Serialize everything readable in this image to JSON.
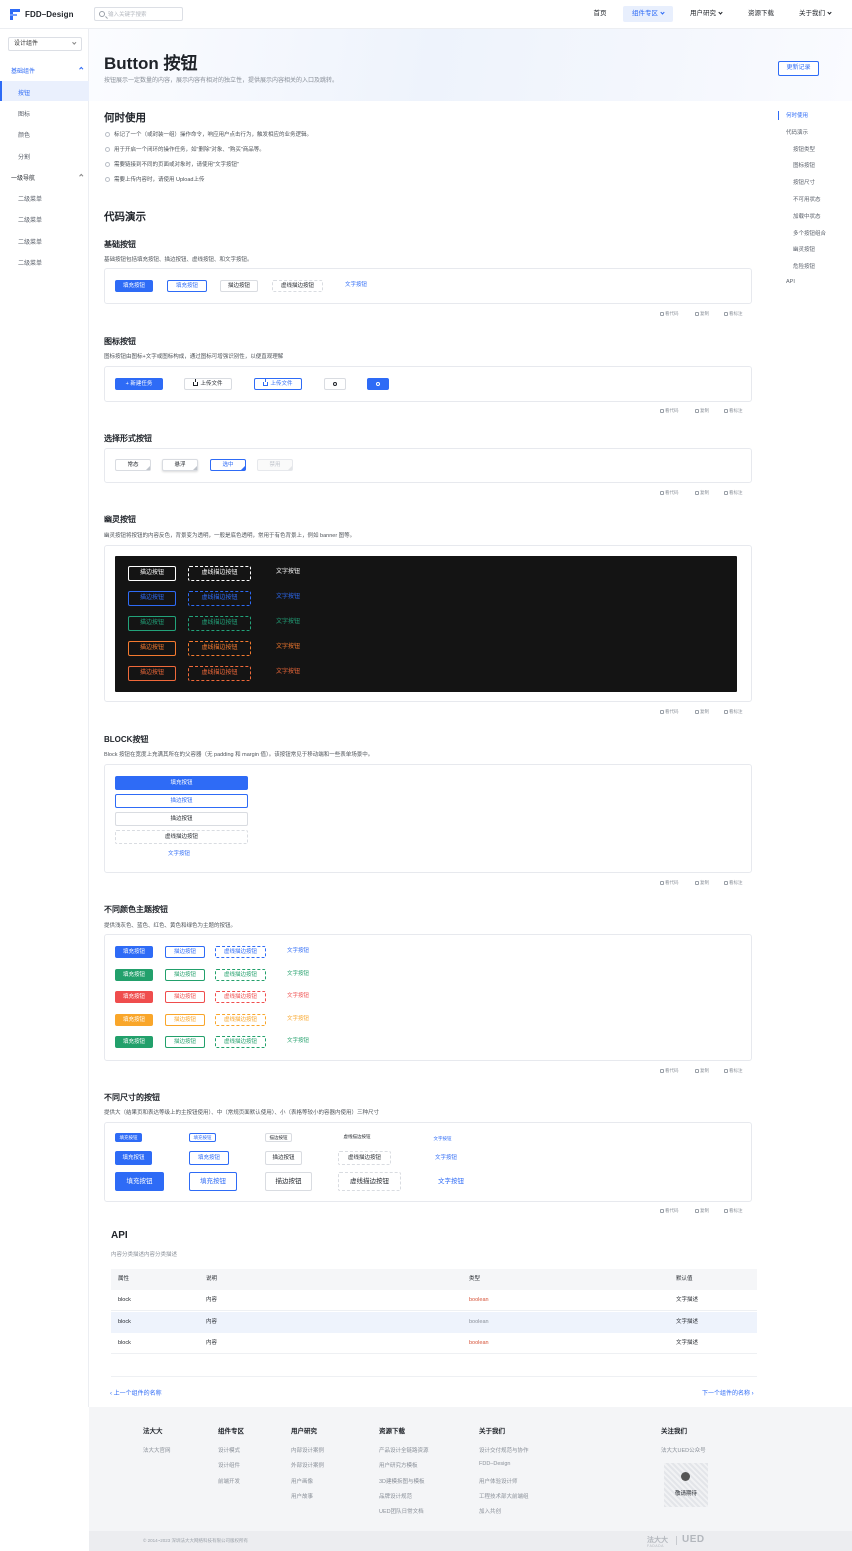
{
  "header": {
    "brand": "FDD–Design",
    "search_placeholder": "输入关键字搜索",
    "nav": [
      "首页",
      "组件专区",
      "用户研究",
      "资源下载",
      "关于我们"
    ]
  },
  "sidebar": {
    "select_value": "设计组件",
    "groups": [
      {
        "label": "基础组件",
        "items": [
          "按钮",
          "图标",
          "颜色",
          "分割"
        ]
      },
      {
        "label": "一级导航",
        "items": [
          "二级菜单",
          "二级菜单",
          "二级菜单",
          "二级菜单"
        ]
      }
    ]
  },
  "page": {
    "title": "Button 按钮",
    "subtitle": "按钮展示一定数量的内容，展示内容有相对的独立性，提供展示内容相关的入口及跳转。",
    "changelog_label": "更新记录"
  },
  "when_to_use": {
    "title": "何时使用",
    "bullets": [
      "标记了一个（或封装一组）操作命令，响应用户点击行为，触发相应的业务逻辑。",
      "用于开启一个闭环的操作任务，如\"删除\"对象、\"购买\"商品等。",
      "需要链接到不同的页面或对象时，请使用\"文字按钮\"",
      "需要上传内容时，请使用 Upload上传"
    ]
  },
  "code_demo_title": "代码演示",
  "tools": [
    "看代码",
    "复制",
    "看标注"
  ],
  "sections": {
    "basic": {
      "title": "基础按钮",
      "desc": "基础按钮包括填充按钮、描边按钮、虚线按钮、和文字按钮。",
      "buttons": [
        "填充按钮",
        "填充按钮",
        "描边按钮",
        "虚线描边按钮",
        "文字按钮"
      ]
    },
    "icon": {
      "title": "图标按钮",
      "desc": "图标按钮由图标+文字或图标构成，通过图标可增强识别性，以便直观理解",
      "buttons": [
        "新建任务",
        "上传文件",
        "上传文件"
      ]
    },
    "choice": {
      "title": "选择形式按钮",
      "buttons": [
        "常态",
        "悬浮",
        "选中",
        "禁用"
      ]
    },
    "ghost": {
      "title": "幽灵按钮",
      "desc": "幽灵按钮将按钮的内容反色，背景变为透明，一般是底色透明，常用于有色背景上，例如 banner 图等。",
      "labels": [
        "描边按钮",
        "虚线描边按钮",
        "文字按钮"
      ],
      "colors": [
        "#ffffff",
        "#2e6bf6",
        "#22a37a",
        "#f57a2f",
        "#f0693a"
      ]
    },
    "block": {
      "title": "BLOCK按钮",
      "desc": "Block 按钮在宽度上充满其所在的父容器（无 padding 和 margin 值）。该按钮常见于移动端和一些表单场景中。",
      "buttons": [
        "填充按钮",
        "描边按钮",
        "描边按钮",
        "虚线描边按钮",
        "文字按钮"
      ]
    },
    "theme": {
      "title": "不同颜色主题按钮",
      "desc": "提供浅灰色、蓝色、红色、黄色和绿色为主题的按钮。",
      "labels": [
        "填充按钮",
        "描边按钮",
        "虚线描边按钮",
        "文字按钮"
      ],
      "colors": [
        "#2e6bf6",
        "#22a06b",
        "#ef4d4d",
        "#f9a62a",
        "#22a06b"
      ]
    },
    "size": {
      "title": "不同尺寸的按钮",
      "desc": "提供大（结果页和表达等级上的主按钮使用）、中（常规页面默认使用）、小（表格等较小的容器内使用）三种尺寸",
      "labels": [
        "填充按钮",
        "填充按钮",
        "描边按钮",
        "虚线描边按钮",
        "文字按钮"
      ]
    }
  },
  "api": {
    "title": "API",
    "subtitle": "内容分类描述内容分类描述",
    "columns": [
      "属性",
      "说明",
      "类型",
      "默认值"
    ],
    "rows": [
      [
        "block",
        "内容",
        "boolean",
        "文字描述"
      ],
      [
        "block",
        "内容",
        "boolean",
        "文字描述"
      ],
      [
        "block",
        "内容",
        "boolean",
        "文字描述"
      ]
    ],
    "type_color": "#d6543a"
  },
  "pager": {
    "prev": "上一个组件的名称",
    "next": "下一个组件的名称"
  },
  "toc": [
    {
      "label": "何时使用",
      "level": 1,
      "active": true
    },
    {
      "label": "代码演示",
      "level": 1
    },
    {
      "label": "按钮类型",
      "level": 2
    },
    {
      "label": "图标按钮",
      "level": 2
    },
    {
      "label": "按钮尺寸",
      "level": 2
    },
    {
      "label": "不可用状态",
      "level": 2
    },
    {
      "label": "加载中状态",
      "level": 2
    },
    {
      "label": "多个按钮组合",
      "level": 2
    },
    {
      "label": "幽灵按钮",
      "level": 2
    },
    {
      "label": "危险按钮",
      "level": 2
    },
    {
      "label": "API",
      "level": 1
    }
  ],
  "footer": {
    "columns": [
      {
        "title": "法大大",
        "links": [
          "法大大官网"
        ]
      },
      {
        "title": "组件专区",
        "links": [
          "设计模式",
          "设计组件",
          "前端开发"
        ]
      },
      {
        "title": "用户研究",
        "links": [
          "内部设计案例",
          "外部设计案例",
          "用户画像",
          "用户故事"
        ]
      },
      {
        "title": "资源下载",
        "links": [
          "产品设计全链路资源",
          "用户研究方模板",
          "3D建模拆图与模板",
          "品牌设计规范",
          "UED团队日常文档"
        ]
      },
      {
        "title": "关于我们",
        "links": [
          "设计交付规范与协作",
          "FDD–Design",
          "用户体验设计师",
          "工程技术部大前端组",
          "加入共创"
        ]
      }
    ],
    "follow_title": "关注我们",
    "follow_sub": "法大大UED公众号",
    "qr_label": "敬请期待",
    "copyright": "© 2014~2023 深圳法大大网络科技有限公司版权所有",
    "logo_cn": "法大大",
    "logo_en": "FADADA",
    "logo_ued": "UED"
  }
}
